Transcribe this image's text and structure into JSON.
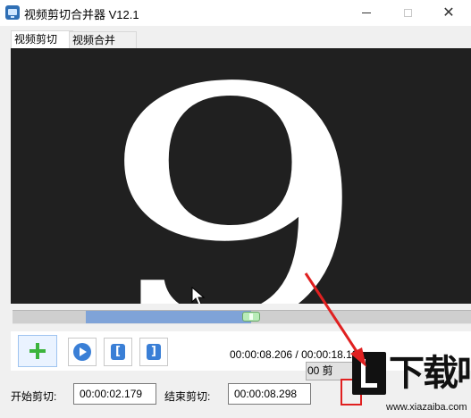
{
  "window": {
    "title": "视频剪切合并器 V12.1",
    "controls": {
      "minimize": "—",
      "maximize": "□",
      "close": "✕"
    }
  },
  "tabs": [
    {
      "label": "视频剪切",
      "active": true
    },
    {
      "label": "视频合并",
      "active": false
    }
  ],
  "video_preview": {
    "frame_glyph": "9",
    "background_color": "#202020",
    "glyph_color": "#ffffff"
  },
  "playback": {
    "progress_fraction": 0.52,
    "played_fraction_start": 0.16,
    "current_time": "00:00:08.206",
    "separator": " / ",
    "total_time": "00:00:18.19",
    "time_tail": "9"
  },
  "controls": {
    "add_icon": "plus-icon",
    "play_icon": "play-icon",
    "mark_in_symbol": "[",
    "mark_out_symbol": "]"
  },
  "cut": {
    "start_label": "开始剪切:",
    "start_value": "00:00:02.179",
    "end_label": "结束剪切:",
    "end_value": "00:00:08.298",
    "cut_button_label": "00 剪"
  },
  "watermark": {
    "brand": "下载吧",
    "url": "www.xiazaiba.com"
  },
  "colors": {
    "progress_played": "#7fa3d8",
    "progress_track": "#cfcfcf",
    "thumb": "#b8ecb8",
    "accent_blue": "#3a7fd6",
    "add_green": "#3cb43c",
    "annotation_red": "#e02020"
  }
}
